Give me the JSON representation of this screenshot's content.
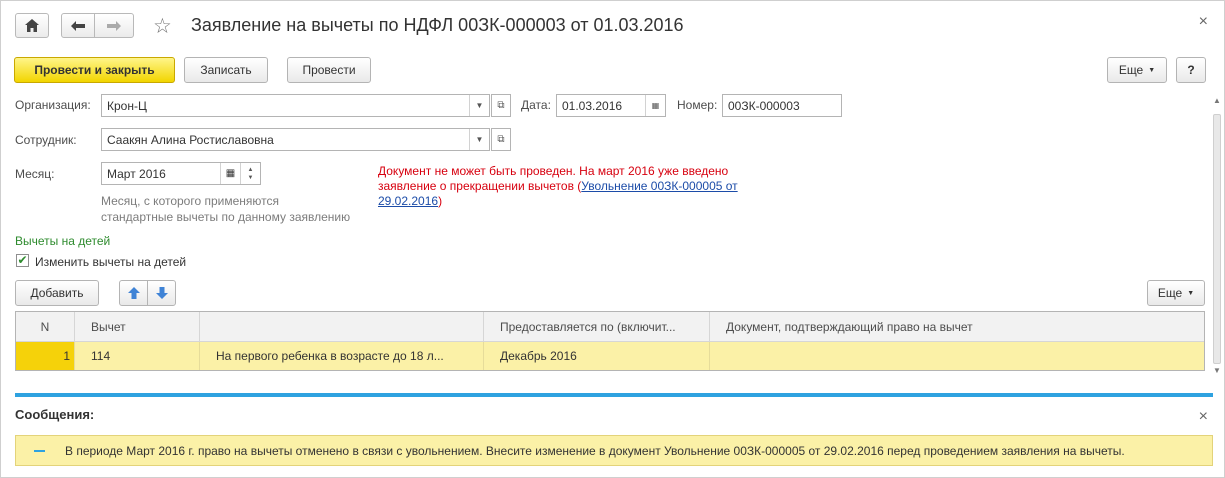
{
  "window": {
    "title": "Заявление на вычеты по НДФЛ 00ЗК-000003 от 01.03.2016",
    "close_symbol": "×"
  },
  "toolbar": {
    "post_close_label": "Провести и закрыть",
    "save_label": "Записать",
    "post_label": "Провести",
    "more_label": "Еще",
    "help_label": "?"
  },
  "form": {
    "organization_label": "Организация:",
    "organization_value": "Крон-Ц",
    "date_label": "Дата:",
    "date_value": "01.03.2016",
    "number_label": "Номер:",
    "number_value": "00ЗК-000003",
    "employee_label": "Сотрудник:",
    "employee_value": "Саакян Алина Ростиславовна",
    "month_label": "Месяц:",
    "month_value": "Март 2016",
    "month_hint_line1": "Месяц, с которого применяются",
    "month_hint_line2": "стандартные вычеты по данному заявлению"
  },
  "error": {
    "line1": "Документ не может быть проведен. На март 2016 уже введено",
    "line2_prefix": "заявление о прекращении вычетов (",
    "link_line1": "Увольнение 00ЗК-000005 от",
    "link_line2": "29.02.2016",
    "suffix": ")"
  },
  "children": {
    "section_title": "Вычеты на детей",
    "checkbox_label": "Изменить вычеты на детей",
    "checkbox_checked": true,
    "add_label": "Добавить",
    "more_label": "Еще"
  },
  "table": {
    "columns": [
      "N",
      "Вычет",
      "",
      "Предоставляется по (включит...",
      "Документ, подтверждающий право на вычет"
    ],
    "rows": [
      {
        "n": "1",
        "code": "114",
        "description": "На первого ребенка в возрасте до 18 л...",
        "until": "Декабрь 2016",
        "document": ""
      }
    ]
  },
  "messages": {
    "title": "Сообщения:",
    "close_symbol": "×",
    "items": [
      "В периоде Март 2016 г. право на вычеты отменено в связи с увольнением. Внесите изменение в документ Увольнение 00ЗК-000005 от 29.02.2016 перед проведением заявления на вычеты."
    ]
  },
  "colors": {
    "primary_button": "#f2d500",
    "error_text": "#d7000f",
    "link": "#1c4ca8",
    "section_title": "#2e8b2e",
    "selected_row": "#fbf1a7",
    "divider": "#2ea2e0"
  }
}
